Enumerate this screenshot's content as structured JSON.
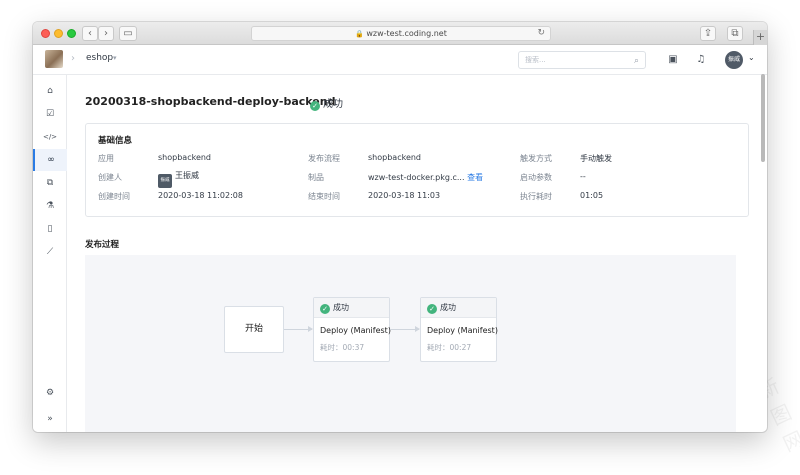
{
  "browser": {
    "url": "wzw-test.coding.net",
    "lock_icon": "lock-icon",
    "reload_icon": "reload-icon",
    "back_icon": "chevron-left-icon",
    "forward_icon": "chevron-right-icon",
    "new_tab_label": "+"
  },
  "header": {
    "project_name": "eshop",
    "search_placeholder": "搜索...",
    "avatar_text": "振威"
  },
  "sidebar": {
    "items": [
      {
        "icon": "home-icon",
        "glyph": "⌂",
        "active": false
      },
      {
        "icon": "task-check-icon",
        "glyph": "☑",
        "active": false
      },
      {
        "icon": "code-icon",
        "glyph": "</>",
        "active": false
      },
      {
        "icon": "cd-pipeline-icon",
        "glyph": "∞",
        "active": true
      },
      {
        "icon": "artifacts-icon",
        "glyph": "⧉",
        "active": false
      },
      {
        "icon": "test-flask-icon",
        "glyph": "⚗",
        "active": false
      },
      {
        "icon": "document-icon",
        "glyph": "▯",
        "active": false
      },
      {
        "icon": "chart-icon",
        "glyph": "⟋",
        "active": false
      }
    ],
    "settings_icon": "gear-icon",
    "collapse_glyph": "»"
  },
  "page": {
    "title": "20200318-shopbackend-deploy-backend",
    "status": "成功"
  },
  "info": {
    "section_title": "基础信息",
    "rows": [
      [
        {
          "label": "应用",
          "value": "shopbackend"
        },
        {
          "label": "发布流程",
          "value": "shopbackend"
        },
        {
          "label": "触发方式",
          "value": "手动触发"
        }
      ],
      [
        {
          "label": "创建人",
          "value": "王振威",
          "avatar": "振威"
        },
        {
          "label": "制品",
          "value": "wzw-test-docker.pkg.c...",
          "link": "查看"
        },
        {
          "label": "启动参数",
          "value": "--"
        }
      ],
      [
        {
          "label": "创建时间",
          "value": "2020-03-18 11:02:08"
        },
        {
          "label": "结束时间",
          "value": "2020-03-18 11:03"
        },
        {
          "label": "执行耗时",
          "value": "01:05"
        }
      ]
    ]
  },
  "process": {
    "section_title": "发布过程",
    "start_label": "开始",
    "stages": [
      {
        "status": "成功",
        "name": "Deploy (Manifest)",
        "duration": "耗时：00:37"
      },
      {
        "status": "成功",
        "name": "Deploy (Manifest)",
        "duration": "耗时：00:27"
      }
    ]
  },
  "watermark": "新图网"
}
